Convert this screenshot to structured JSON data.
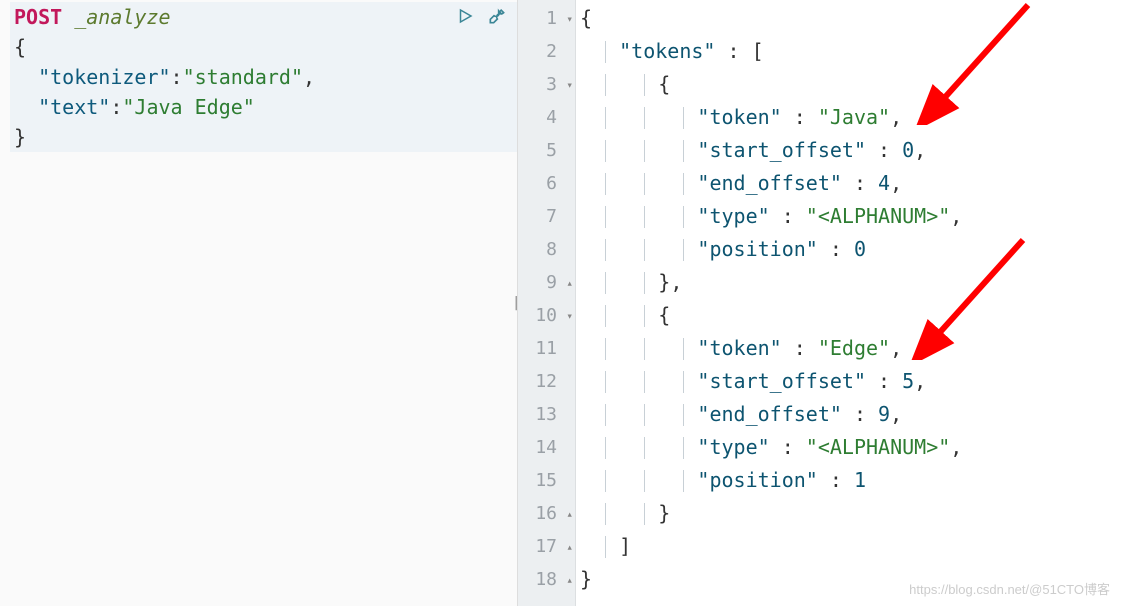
{
  "request": {
    "method": "POST",
    "endpoint": "_analyze",
    "body_lines": [
      {
        "t": "open",
        "text": "{"
      },
      {
        "t": "kv",
        "indent": "  ",
        "key": "\"tokenizer\"",
        "val": "\"standard\"",
        "trail": ","
      },
      {
        "t": "kv",
        "indent": "  ",
        "key": "\"text\"",
        "val": "\"Java Edge\"",
        "trail": ""
      },
      {
        "t": "close",
        "text": "}"
      }
    ]
  },
  "response": {
    "lines": [
      {
        "n": "1",
        "fold": "▾",
        "seg": [
          {
            "p": "{"
          }
        ]
      },
      {
        "n": "2",
        "fold": "",
        "seg": [
          {
            "i": 4
          },
          {
            "k": "\"tokens\""
          },
          {
            "p": " : ["
          }
        ]
      },
      {
        "n": "3",
        "fold": "▾",
        "seg": [
          {
            "i": 8
          },
          {
            "p": "{"
          }
        ]
      },
      {
        "n": "4",
        "fold": "",
        "seg": [
          {
            "i": 12
          },
          {
            "k": "\"token\""
          },
          {
            "p": " : "
          },
          {
            "s": "\"Java\""
          },
          {
            "p": ","
          }
        ]
      },
      {
        "n": "5",
        "fold": "",
        "seg": [
          {
            "i": 12
          },
          {
            "k": "\"start_offset\""
          },
          {
            "p": " : "
          },
          {
            "num": "0"
          },
          {
            "p": ","
          }
        ]
      },
      {
        "n": "6",
        "fold": "",
        "seg": [
          {
            "i": 12
          },
          {
            "k": "\"end_offset\""
          },
          {
            "p": " : "
          },
          {
            "num": "4"
          },
          {
            "p": ","
          }
        ]
      },
      {
        "n": "7",
        "fold": "",
        "seg": [
          {
            "i": 12
          },
          {
            "k": "\"type\""
          },
          {
            "p": " : "
          },
          {
            "s": "\"<ALPHANUM>\""
          },
          {
            "p": ","
          }
        ]
      },
      {
        "n": "8",
        "fold": "",
        "seg": [
          {
            "i": 12
          },
          {
            "k": "\"position\""
          },
          {
            "p": " : "
          },
          {
            "num": "0"
          }
        ]
      },
      {
        "n": "9",
        "fold": "▴",
        "seg": [
          {
            "i": 8
          },
          {
            "p": "},"
          }
        ]
      },
      {
        "n": "10",
        "fold": "▾",
        "seg": [
          {
            "i": 8
          },
          {
            "p": "{"
          }
        ]
      },
      {
        "n": "11",
        "fold": "",
        "seg": [
          {
            "i": 12
          },
          {
            "k": "\"token\""
          },
          {
            "p": " : "
          },
          {
            "s": "\"Edge\""
          },
          {
            "p": ","
          }
        ]
      },
      {
        "n": "12",
        "fold": "",
        "seg": [
          {
            "i": 12
          },
          {
            "k": "\"start_offset\""
          },
          {
            "p": " : "
          },
          {
            "num": "5"
          },
          {
            "p": ","
          }
        ]
      },
      {
        "n": "13",
        "fold": "",
        "seg": [
          {
            "i": 12
          },
          {
            "k": "\"end_offset\""
          },
          {
            "p": " : "
          },
          {
            "num": "9"
          },
          {
            "p": ","
          }
        ]
      },
      {
        "n": "14",
        "fold": "",
        "seg": [
          {
            "i": 12
          },
          {
            "k": "\"type\""
          },
          {
            "p": " : "
          },
          {
            "s": "\"<ALPHANUM>\""
          },
          {
            "p": ","
          }
        ]
      },
      {
        "n": "15",
        "fold": "",
        "seg": [
          {
            "i": 12
          },
          {
            "k": "\"position\""
          },
          {
            "p": " : "
          },
          {
            "num": "1"
          }
        ]
      },
      {
        "n": "16",
        "fold": "▴",
        "seg": [
          {
            "i": 8
          },
          {
            "p": "}"
          }
        ]
      },
      {
        "n": "17",
        "fold": "▴",
        "seg": [
          {
            "i": 4
          },
          {
            "p": "]"
          }
        ]
      },
      {
        "n": "18",
        "fold": "▴",
        "seg": [
          {
            "p": "}"
          }
        ]
      }
    ]
  },
  "watermark": "https://blog.csdn.net/@51CTO博客"
}
